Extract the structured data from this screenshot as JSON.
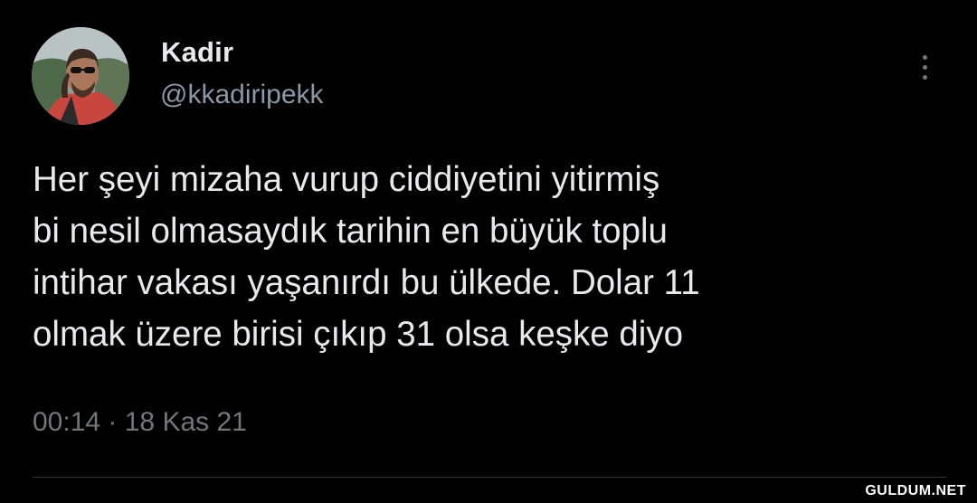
{
  "author": {
    "display_name": "Kadir",
    "handle": "@kkadiripekk"
  },
  "tweet": {
    "lines": [
      "Her şeyi mizaha vurup ciddiyetini yitirmiş",
      "bi nesil olmasaydık tarihin en büyük toplu",
      "intihar vakası yaşanırdı bu ülkede. Dolar 11",
      "olmak üzere birisi çıkıp 31 olsa keşke diyo"
    ],
    "timestamp": "00:14 · 18 Kas 21"
  },
  "icons": {
    "more": "more-vertical-icon"
  },
  "watermark": "GULDUM.NET",
  "colors": {
    "background": "#000000",
    "primary_text": "#e7e9ea",
    "secondary_text": "#71767b",
    "divider": "#2f3336"
  }
}
